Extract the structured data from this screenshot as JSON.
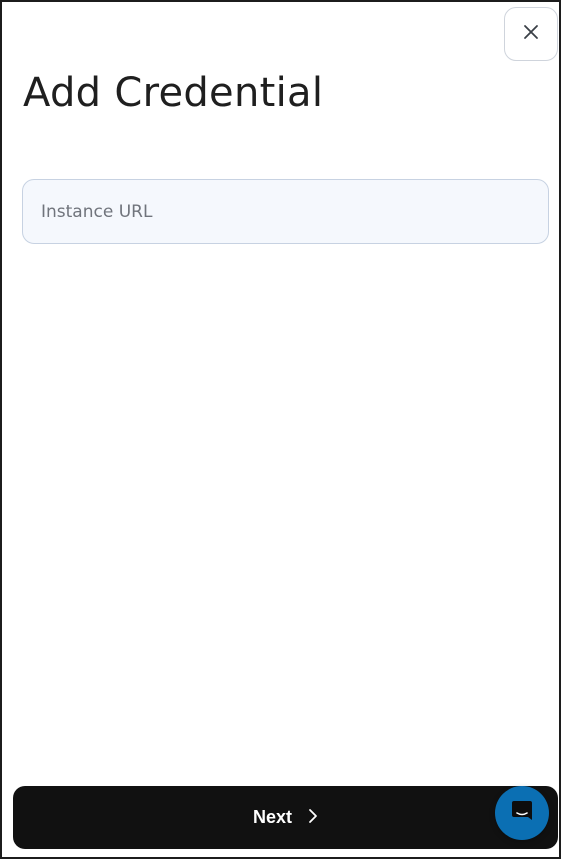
{
  "dialog": {
    "title": "Add Credential",
    "close_icon": "close-icon"
  },
  "form": {
    "instance_url": {
      "value": "",
      "placeholder": "Instance URL"
    }
  },
  "footer": {
    "next_label": "Next",
    "next_icon": "chevron-right-icon"
  },
  "chat_widget": {
    "icon": "chat-bubble-icon",
    "color": "#0b6fb3"
  }
}
